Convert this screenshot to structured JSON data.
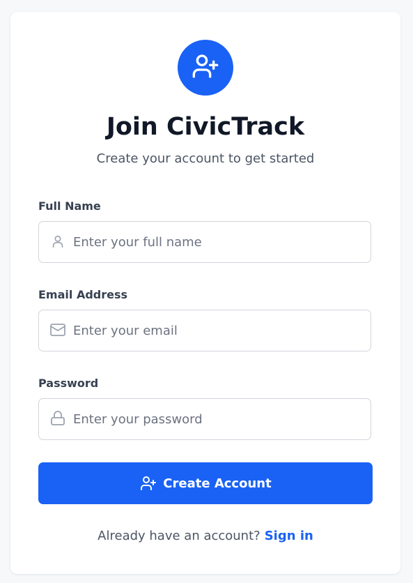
{
  "header": {
    "icon": "user-plus-icon",
    "title": "Join CivicTrack",
    "subtitle": "Create your account to get started"
  },
  "form": {
    "full_name": {
      "label": "Full Name",
      "placeholder": "Enter your full name",
      "value": "",
      "icon": "user-icon"
    },
    "email": {
      "label": "Email Address",
      "placeholder": "Enter your email",
      "value": "",
      "icon": "mail-icon"
    },
    "password": {
      "label": "Password",
      "placeholder": "Enter your password",
      "value": "",
      "icon": "lock-icon"
    },
    "submit": {
      "label": "Create Account",
      "icon": "user-plus-icon"
    }
  },
  "footer": {
    "prompt": "Already have an account?",
    "link_label": "Sign in"
  },
  "colors": {
    "accent": "#1a62f5",
    "title": "#111827",
    "muted_text": "#4b5563",
    "border": "#d1d5db",
    "page_background": "#f6f8fa"
  }
}
